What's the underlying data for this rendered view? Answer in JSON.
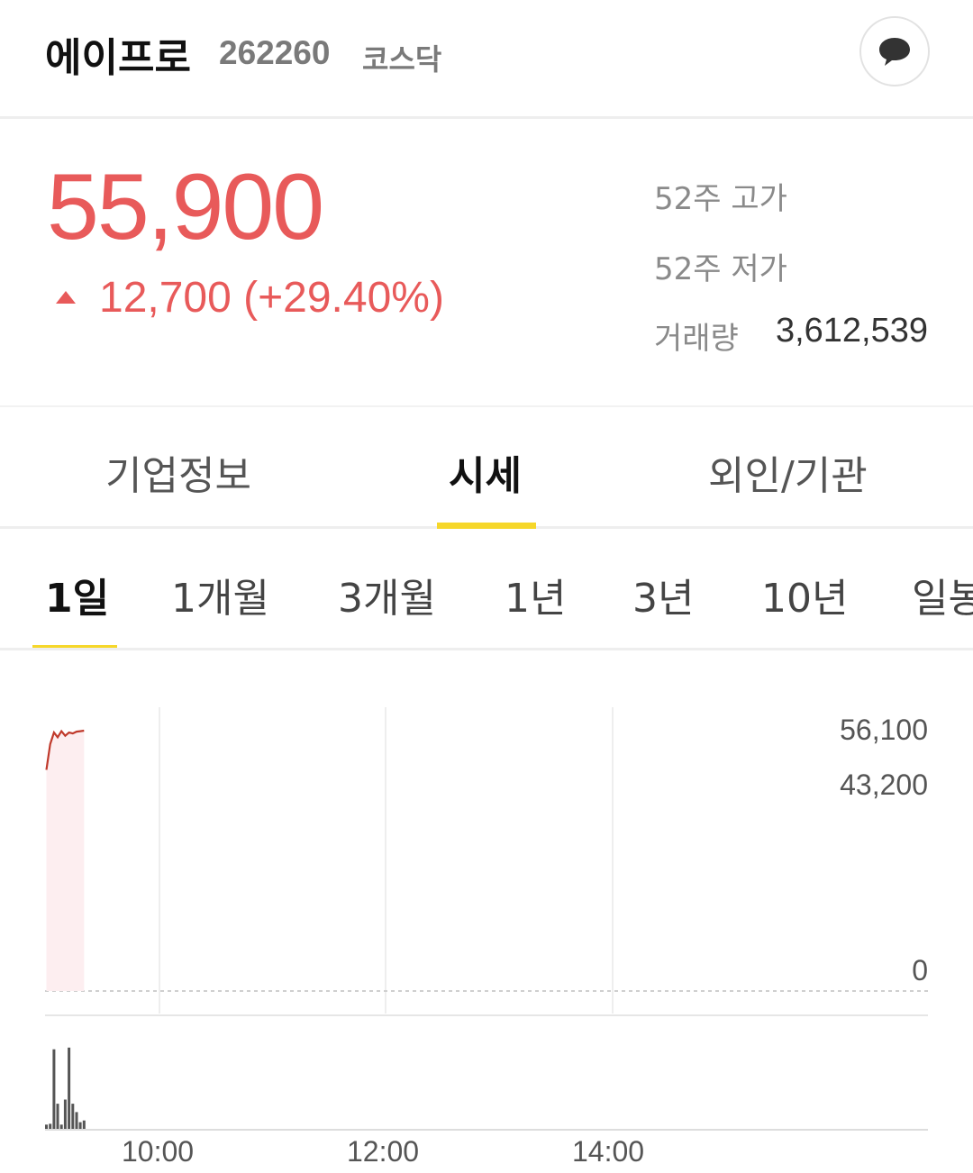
{
  "header": {
    "name": "에이프로",
    "code": "262260",
    "market": "코스닥",
    "chat_icon": "chat-bubble-icon"
  },
  "quote": {
    "price": "55,900",
    "change": "12,700 (+29.40%)",
    "direction": "up",
    "up_color": "#e85a5a"
  },
  "stats": {
    "high52_label": "52주 고가",
    "low52_label": "52주 저가",
    "volume_label": "거래량",
    "volume_value": "3,612,539"
  },
  "tabs": [
    {
      "label": "기업정보",
      "active": false
    },
    {
      "label": "시세",
      "active": true
    },
    {
      "label": "외인/기관",
      "active": false
    }
  ],
  "periods": [
    {
      "label": "1일",
      "active": true
    },
    {
      "label": "1개월",
      "active": false
    },
    {
      "label": "3개월",
      "active": false
    },
    {
      "label": "1년",
      "active": false
    },
    {
      "label": "3년",
      "active": false
    },
    {
      "label": "10년",
      "active": false
    },
    {
      "label": "일봉",
      "active": false
    }
  ],
  "chart_data": {
    "type": "line",
    "y_tick_labels": [
      "56,100",
      "43,200",
      "0"
    ],
    "x_tick_labels": [
      "10:00",
      "12:00",
      "14:00"
    ],
    "ylim": [
      0,
      56100
    ],
    "line_color": "#c0392b",
    "fill_color": "#fdeef0",
    "price_series": {
      "x": [
        "09:00",
        "09:02",
        "09:04",
        "09:06",
        "09:08",
        "09:10",
        "09:12",
        "09:14",
        "09:16",
        "09:18",
        "09:20"
      ],
      "values": [
        47500,
        53000,
        55500,
        54500,
        55800,
        54800,
        55500,
        55300,
        55700,
        55800,
        55900
      ]
    },
    "volume_series": {
      "x": [
        "09:00",
        "09:02",
        "09:04",
        "09:06",
        "09:08",
        "09:10",
        "09:12",
        "09:14",
        "09:16",
        "09:18",
        "09:20"
      ],
      "relative_values": [
        0.05,
        0.06,
        0.95,
        0.3,
        0.05,
        0.35,
        0.97,
        0.3,
        0.2,
        0.08,
        0.1
      ]
    }
  }
}
